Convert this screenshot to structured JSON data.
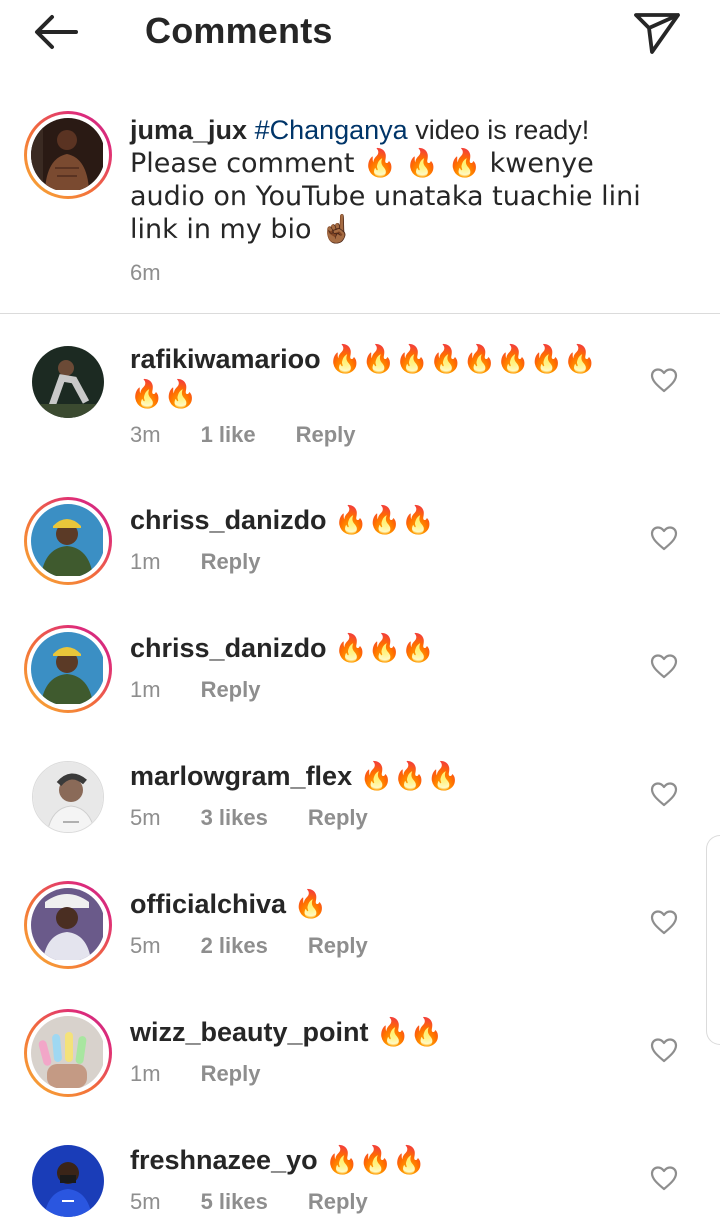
{
  "header": {
    "title": "Comments"
  },
  "caption": {
    "username": "juma_jux",
    "hashtag": "#Changanya",
    "text_before": " video is ready!",
    "text_line2": "Please comment 🔥 🔥 🔥 kwenye audio on YouTube unataka tuachie lini  link in my bio ☝🏾",
    "time": "6m"
  },
  "comments": [
    {
      "username": "rafikiwamarioo",
      "text": "🔥🔥🔥🔥🔥🔥🔥🔥🔥🔥",
      "time": "3m",
      "likes": "1 like",
      "reply": "Reply"
    },
    {
      "username": "chriss_danizdo",
      "text": "🔥🔥🔥",
      "time": "1m",
      "likes": "",
      "reply": "Reply"
    },
    {
      "username": "chriss_danizdo",
      "text": "🔥🔥🔥",
      "time": "1m",
      "likes": "",
      "reply": "Reply"
    },
    {
      "username": "marlowgram_flex",
      "text": "🔥🔥🔥",
      "time": "5m",
      "likes": "3 likes",
      "reply": "Reply"
    },
    {
      "username": "officialchiva",
      "text": "🔥",
      "time": "5m",
      "likes": "2 likes",
      "reply": "Reply"
    },
    {
      "username": "wizz_beauty_point",
      "text": "🔥🔥",
      "time": "1m",
      "likes": "",
      "reply": "Reply"
    },
    {
      "username": "freshnazee_yo",
      "text": "🔥🔥🔥",
      "time": "5m",
      "likes": "5 likes",
      "reply": "Reply"
    }
  ]
}
